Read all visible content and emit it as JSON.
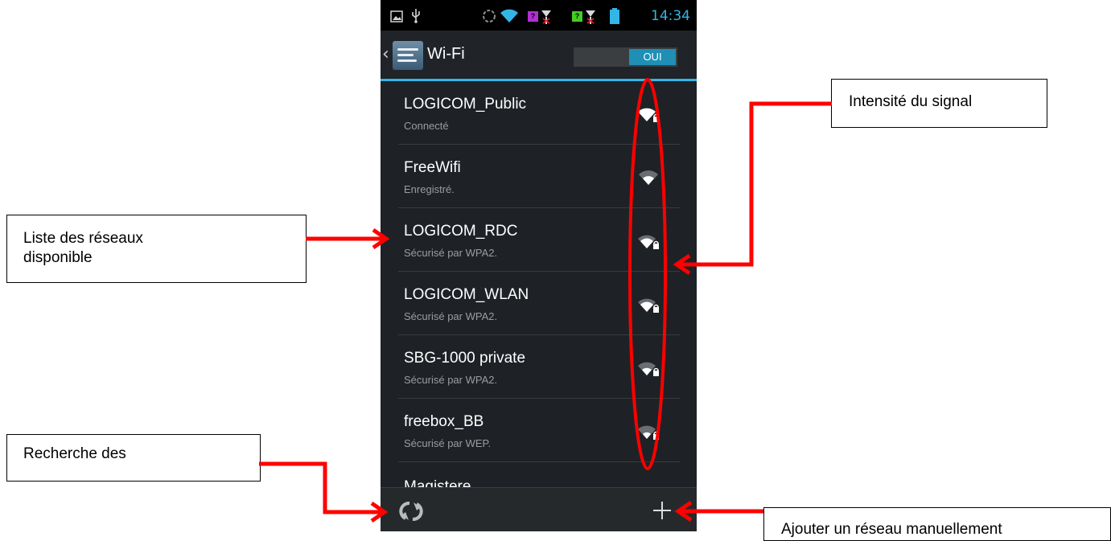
{
  "statusbar": {
    "time": "14:34",
    "sim1_label": "?",
    "sim2_label": "?",
    "accent_color": "#33b5e5"
  },
  "actionbar": {
    "title": "Wi-Fi",
    "toggle_label": "OUI"
  },
  "networks": [
    {
      "name": "LOGICOM_Public",
      "status": "Connecté",
      "icon": "wifi-lock-icon"
    },
    {
      "name": "FreeWifi",
      "status": "Enregistré.",
      "icon": "wifi-icon"
    },
    {
      "name": "LOGICOM_RDC",
      "status": "Sécurisé par WPA2.",
      "icon": "wifi-lock-icon"
    },
    {
      "name": "LOGICOM_WLAN",
      "status": "Sécurisé par WPA2.",
      "icon": "wifi-lock-icon"
    },
    {
      "name": "SBG-1000 private",
      "status": "Sécurisé par WPA2.",
      "icon": "wifi-lock-icon"
    },
    {
      "name": "freebox_BB",
      "status": "Sécurisé par WEP.",
      "icon": "wifi-lock-icon"
    }
  ],
  "partial_network": "Magistere",
  "bottombar": {
    "refresh_icon": "refresh-icon",
    "add_icon": "plus-icon"
  },
  "annotations": {
    "signal": "Intensité du signal",
    "list_line1": "Liste des réseaux",
    "list_line2": "disponible",
    "search": "Recherche des",
    "add": "Ajouter un réseau manuellement",
    "arrow_color": "#ff0000"
  }
}
